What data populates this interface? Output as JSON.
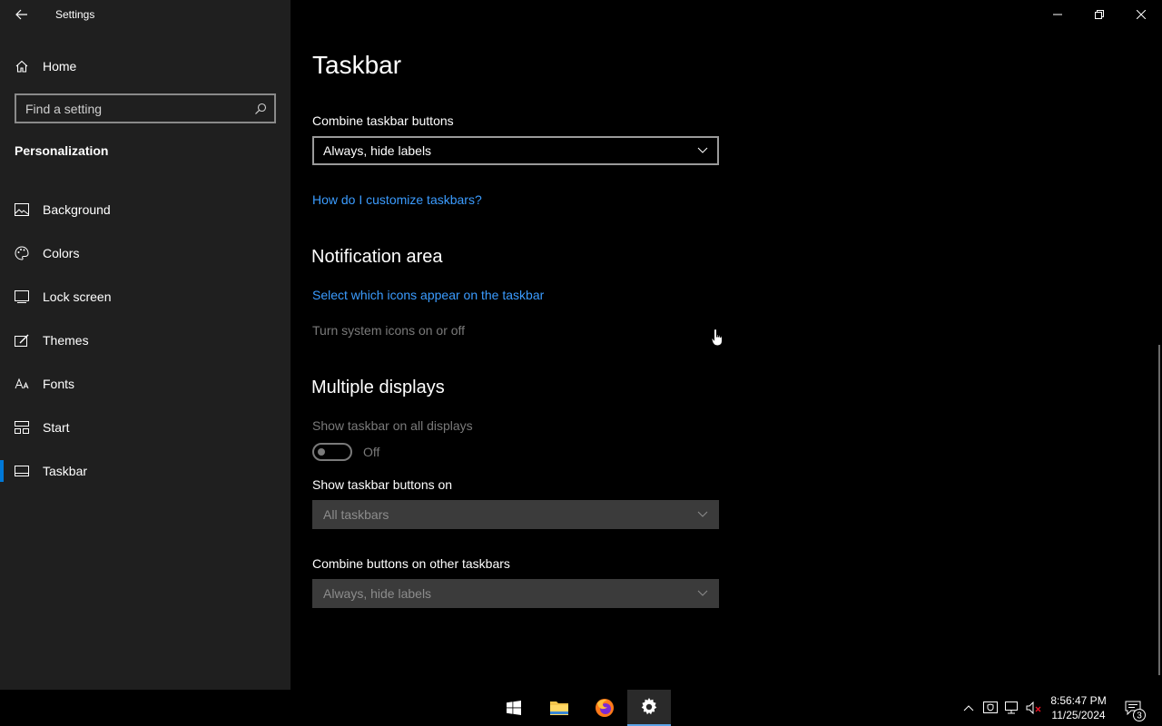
{
  "window": {
    "title": "Settings"
  },
  "sidebar": {
    "home_label": "Home",
    "search_placeholder": "Find a setting",
    "section_title": "Personalization",
    "items": [
      {
        "label": "Background",
        "icon": "image-icon"
      },
      {
        "label": "Colors",
        "icon": "palette-icon"
      },
      {
        "label": "Lock screen",
        "icon": "lock-screen-icon"
      },
      {
        "label": "Themes",
        "icon": "themes-icon"
      },
      {
        "label": "Fonts",
        "icon": "fonts-icon"
      },
      {
        "label": "Start",
        "icon": "start-icon"
      },
      {
        "label": "Taskbar",
        "icon": "taskbar-icon",
        "active": true
      }
    ]
  },
  "main": {
    "title": "Taskbar",
    "combine_label": "Combine taskbar buttons",
    "combine_value": "Always, hide labels",
    "customize_link": "How do I customize taskbars?",
    "notification_heading": "Notification area",
    "select_icons_link": "Select which icons appear on the taskbar",
    "system_icons_link": "Turn system icons on or off",
    "multiple_heading": "Multiple displays",
    "show_all_label": "Show taskbar on all displays",
    "show_all_state": "Off",
    "show_buttons_label": "Show taskbar buttons on",
    "show_buttons_value": "All taskbars",
    "combine_other_label": "Combine buttons on other taskbars",
    "combine_other_value": "Always, hide labels"
  },
  "taskbar": {
    "time": "8:56:47 PM",
    "date": "11/25/2024",
    "notification_count": "3",
    "accent": "#0078d7"
  }
}
